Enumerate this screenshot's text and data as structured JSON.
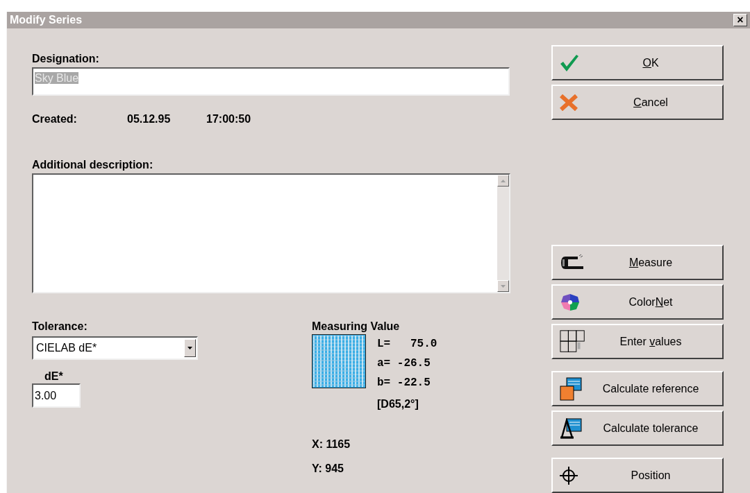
{
  "window": {
    "title": "Modify Series",
    "close": "×"
  },
  "designation": {
    "label": "Designation:",
    "value": "Sky Blue",
    "text_selected": true
  },
  "created": {
    "label": "Created:",
    "date": "05.12.95",
    "time": "17:00:50"
  },
  "description": {
    "label": "Additional description:"
  },
  "tolerance": {
    "label": "Tolerance:",
    "value": "CIELAB dE*",
    "de_label": "dE*",
    "de_value": "3.00"
  },
  "measuring": {
    "title": "Measuring Value",
    "rows": [
      "L=   75.0",
      "a= -26.5",
      "b= -22.5"
    ],
    "illuminant": "[D65,2°]",
    "x": "X: 1165",
    "y": "Y: 945"
  },
  "button_groups": [
    [
      {
        "kind": "ok",
        "key": "O",
        "post": "K"
      },
      {
        "kind": "cancel",
        "key": "C",
        "post": "ancel"
      }
    ],
    [
      {
        "kind": "measure",
        "key": "M",
        "post": "easure"
      },
      {
        "kind": "colornet",
        "pre": "Color",
        "key": "N",
        "post": "et"
      },
      {
        "kind": "enter",
        "pre": "Enter ",
        "key": "v",
        "post": "alues"
      }
    ],
    [
      {
        "kind": "calcref",
        "pre": "Calculate reference"
      },
      {
        "kind": "calctol",
        "pre": "Calculate tolerance"
      }
    ],
    [
      {
        "kind": "position",
        "pre": "Position"
      }
    ]
  ]
}
